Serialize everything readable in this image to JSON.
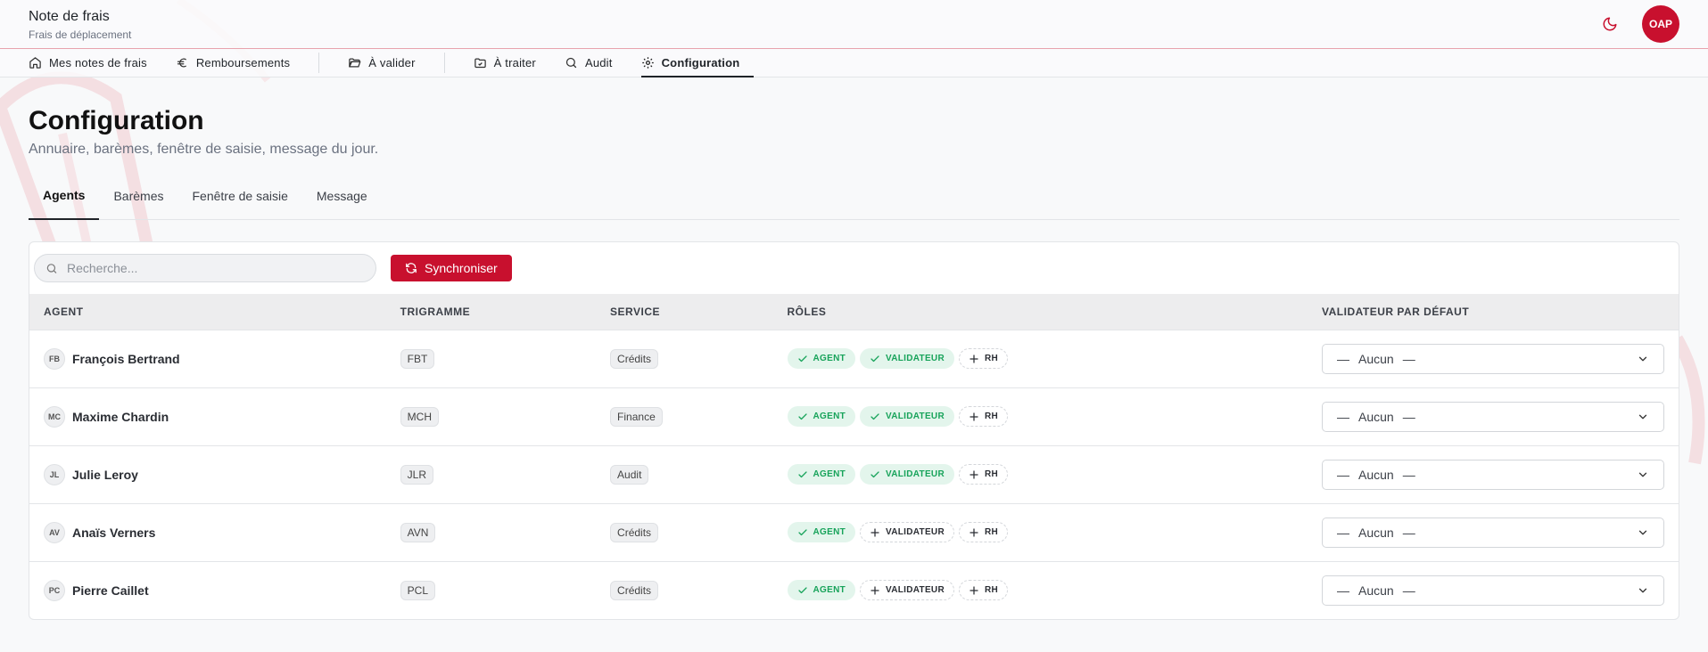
{
  "app": {
    "title": "Note de frais",
    "subtitle": "Frais de déplacement",
    "user_initials": "OAP"
  },
  "nav": [
    {
      "label": "Mes notes de frais",
      "icon": "home-icon"
    },
    {
      "label": "Remboursements",
      "icon": "euro-icon"
    },
    {
      "label": "À valider",
      "icon": "folder-open-icon"
    },
    {
      "label": "À traiter",
      "icon": "folder-check-icon"
    },
    {
      "label": "Audit",
      "icon": "search-icon"
    },
    {
      "label": "Configuration",
      "icon": "gear-icon",
      "active": true
    }
  ],
  "page": {
    "title": "Configuration",
    "subtitle": "Annuaire, barèmes, fenêtre de saisie, message du jour."
  },
  "tabs": [
    {
      "label": "Agents",
      "active": true
    },
    {
      "label": "Barèmes"
    },
    {
      "label": "Fenêtre de saisie"
    },
    {
      "label": "Message"
    }
  ],
  "toolbar": {
    "search_placeholder": "Recherche...",
    "sync_label": "Synchroniser"
  },
  "table": {
    "headers": [
      "AGENT",
      "TRIGRAMME",
      "SERVICE",
      "RÔLES",
      "VALIDATEUR PAR DÉFAUT"
    ],
    "rows": [
      {
        "initials": "FB",
        "name": "François Bertrand",
        "trigram": "FBT",
        "service": "Crédits",
        "roles": [
          {
            "label": "AGENT",
            "on": true
          },
          {
            "label": "VALIDATEUR",
            "on": true
          },
          {
            "label": "RH",
            "on": false
          }
        ],
        "validator": "Aucun"
      },
      {
        "initials": "MC",
        "name": "Maxime Chardin",
        "trigram": "MCH",
        "service": "Finance",
        "roles": [
          {
            "label": "AGENT",
            "on": true
          },
          {
            "label": "VALIDATEUR",
            "on": true
          },
          {
            "label": "RH",
            "on": false
          }
        ],
        "validator": "Aucun"
      },
      {
        "initials": "JL",
        "name": "Julie Leroy",
        "trigram": "JLR",
        "service": "Audit",
        "roles": [
          {
            "label": "AGENT",
            "on": true
          },
          {
            "label": "VALIDATEUR",
            "on": true
          },
          {
            "label": "RH",
            "on": false
          }
        ],
        "validator": "Aucun"
      },
      {
        "initials": "AV",
        "name": "Anaïs Verners",
        "trigram": "AVN",
        "service": "Crédits",
        "roles": [
          {
            "label": "AGENT",
            "on": true
          },
          {
            "label": "VALIDATEUR",
            "on": false
          },
          {
            "label": "RH",
            "on": false
          }
        ],
        "validator": "Aucun"
      },
      {
        "initials": "PC",
        "name": "Pierre Caillet",
        "trigram": "PCL",
        "service": "Crédits",
        "roles": [
          {
            "label": "AGENT",
            "on": true
          },
          {
            "label": "VALIDATEUR",
            "on": false
          },
          {
            "label": "RH",
            "on": false
          }
        ],
        "validator": "Aucun"
      }
    ]
  },
  "colors": {
    "accent": "#c8102e",
    "role_on_bg": "#e3f5ec",
    "role_on_text": "#17a35a"
  }
}
